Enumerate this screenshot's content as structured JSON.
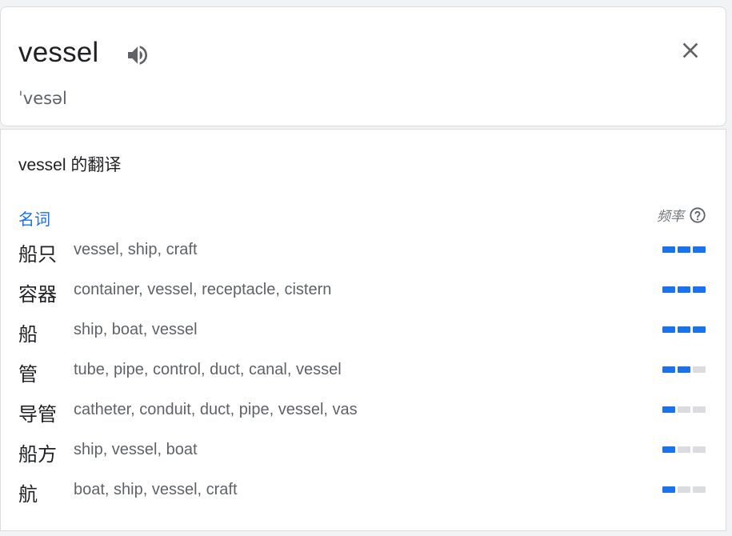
{
  "header": {
    "word": "vessel",
    "phonetic": "ˈvesəl"
  },
  "translations": {
    "title": "vessel 的翻译",
    "part_of_speech": "名词",
    "frequency_label": "频率",
    "rows": [
      {
        "term": "船只",
        "synonyms": "vessel, ship, craft",
        "frequency": 3
      },
      {
        "term": "容器",
        "synonyms": "container, vessel, receptacle, cistern",
        "frequency": 3
      },
      {
        "term": "船",
        "synonyms": "ship, boat, vessel",
        "frequency": 3
      },
      {
        "term": "管",
        "synonyms": "tube, pipe, control, duct, canal, vessel",
        "frequency": 2
      },
      {
        "term": "导管",
        "synonyms": "catheter, conduit, duct, pipe, vessel, vas",
        "frequency": 1
      },
      {
        "term": "船方",
        "synonyms": "ship, vessel, boat",
        "frequency": 1
      },
      {
        "term": "航",
        "synonyms": "boat, ship, vessel, craft",
        "frequency": 1
      }
    ]
  },
  "colors": {
    "accent": "#1a73e8",
    "inactive_bar": "#dadce0"
  },
  "icons": {
    "speaker": "speaker-icon",
    "close": "close-icon",
    "help": "help-icon"
  }
}
